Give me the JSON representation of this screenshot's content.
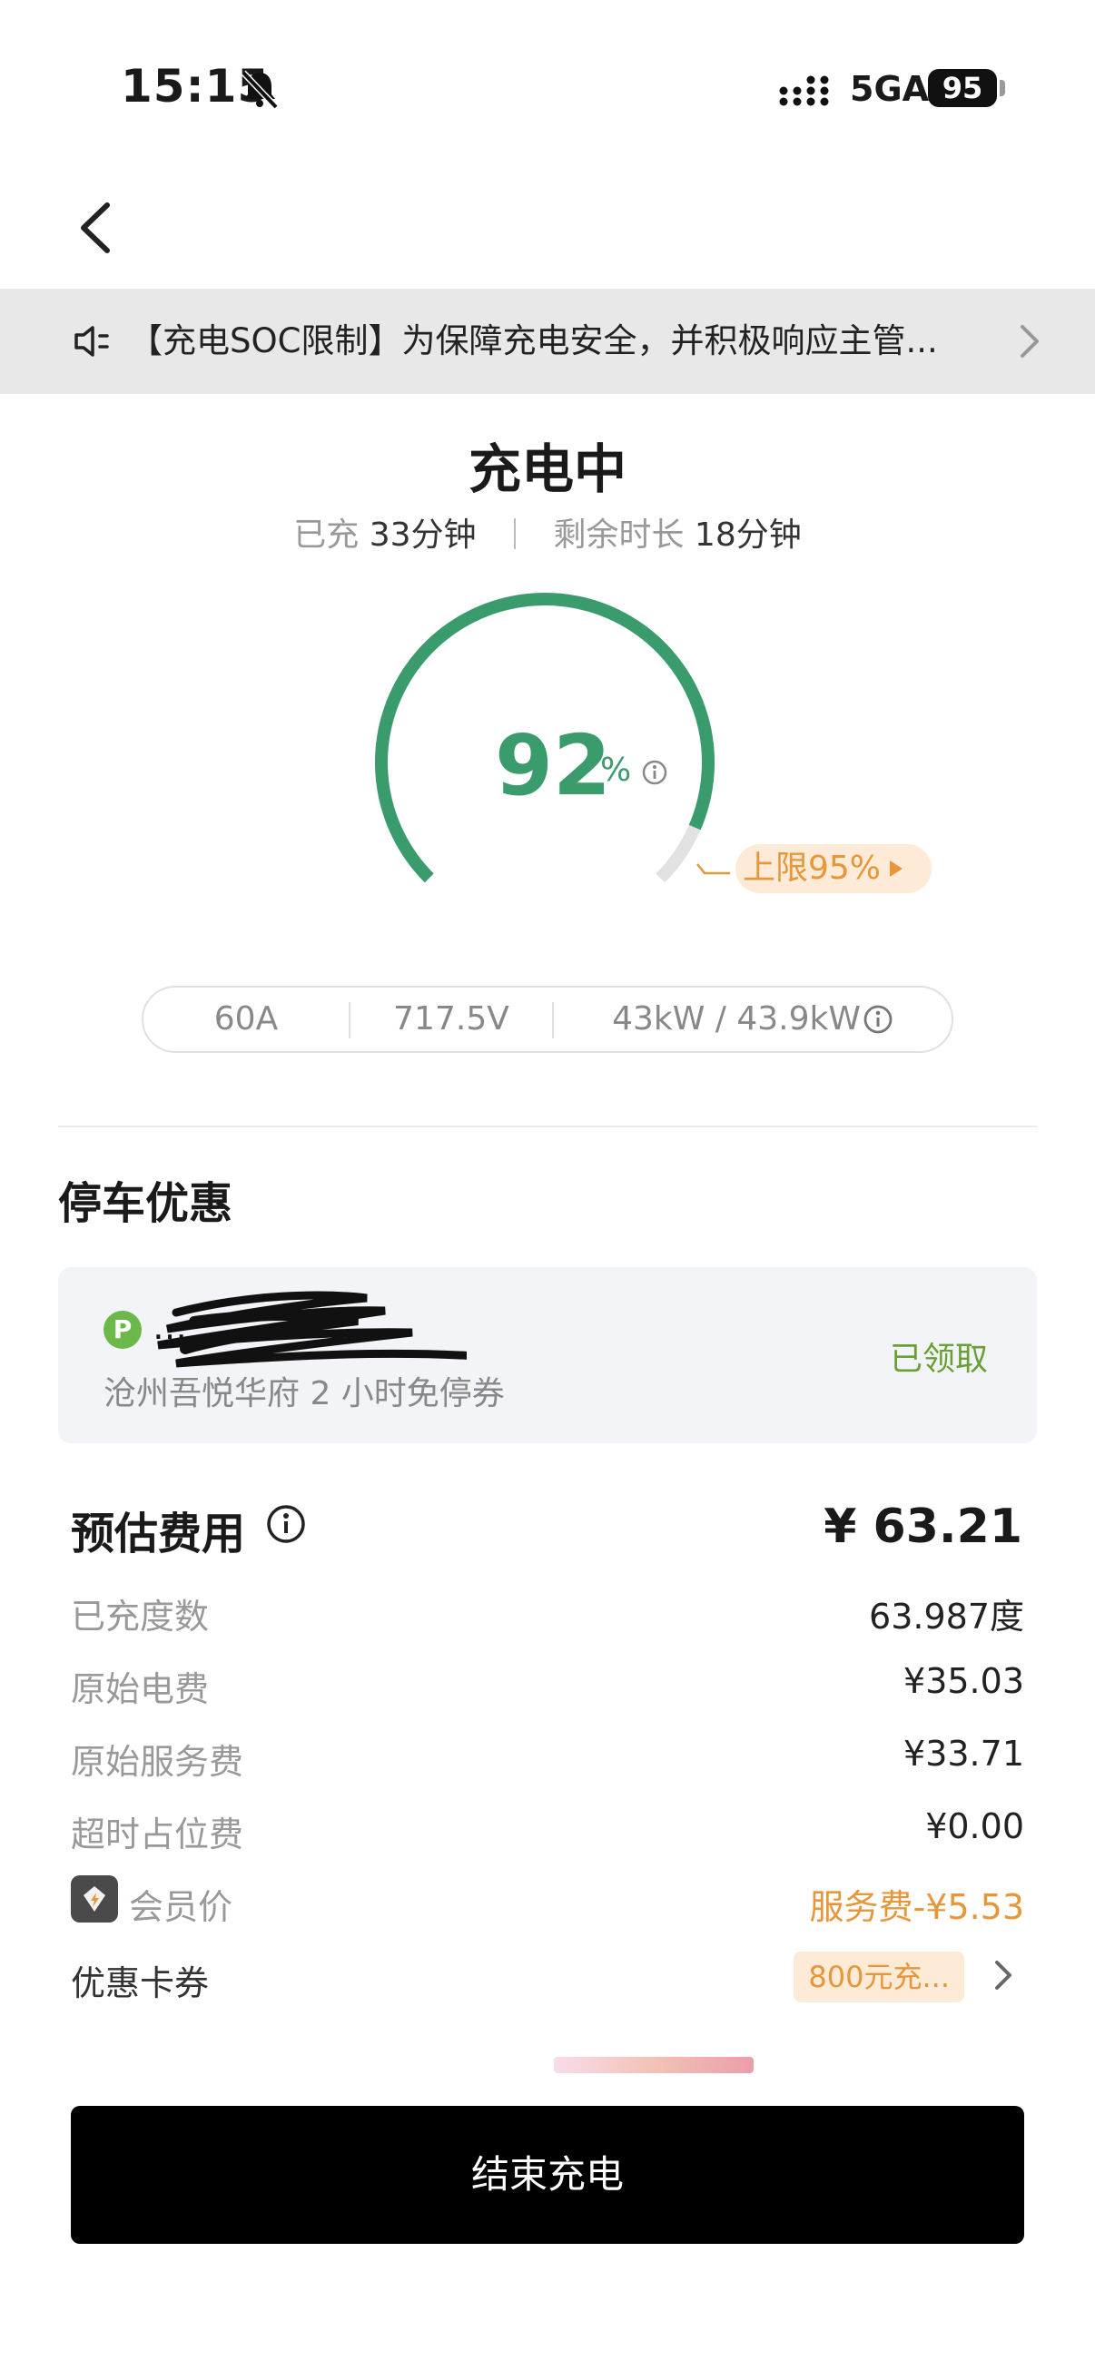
{
  "status_bar": {
    "time": "15:15",
    "network": "5GA",
    "battery": "95"
  },
  "notice": {
    "text": "【充电SOC限制】为保障充电安全，并积极响应主管..."
  },
  "charge": {
    "title": "充电中",
    "charged_label": "已充",
    "charged_value": "33分钟",
    "remaining_label": "剩余时长",
    "remaining_value": "18分钟",
    "soc_value": "92",
    "soc_unit": "%",
    "soc_percent": 92,
    "limit_label": "上限95%",
    "limit_percent": 95
  },
  "metrics": {
    "current": "60A",
    "voltage": "717.5V",
    "power": "43kW / 43.9kW"
  },
  "parking": {
    "title": "停车优惠",
    "badge": "P",
    "name": "…",
    "description": "沧州吾悦华府 2 小时免停券",
    "status": "已领取"
  },
  "fees": {
    "title": "预估费用",
    "total": "¥ 63.21",
    "rows": [
      {
        "label": "已充度数",
        "value": "63.987度"
      },
      {
        "label": "原始电费",
        "value": "¥35.03"
      },
      {
        "label": "原始服务费",
        "value": "¥33.71"
      },
      {
        "label": "超时占位费",
        "value": "¥0.00"
      }
    ],
    "member_label": "会员价",
    "member_value": "服务费-¥5.53",
    "coupon_label": "优惠卡券",
    "coupon_value": "800元充..."
  },
  "actions": {
    "end_charge": "结束充电"
  },
  "colors": {
    "green": "#3a9c6c",
    "orange": "#e8963a",
    "light_orange": "#fdebd7",
    "card_bg": "#f3f4f7"
  }
}
